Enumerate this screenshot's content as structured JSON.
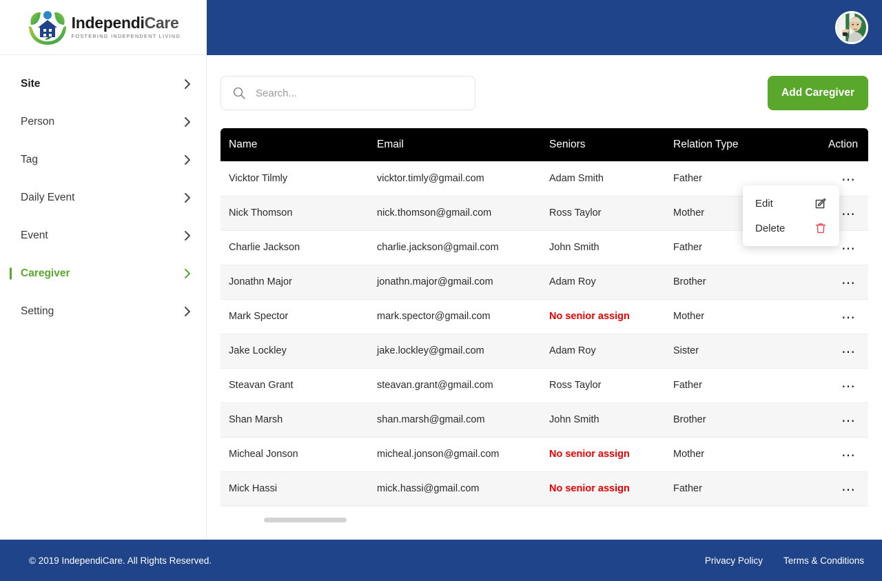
{
  "brand": {
    "logo_icon": "independicare-logo-icon",
    "name_part1": "Independi",
    "name_part2": "Care",
    "tagline": "FOSTERING INDEPENDENT LIVING"
  },
  "header": {
    "avatar_icon": "user-avatar",
    "bg_color": "#1f4489"
  },
  "sidebar": {
    "items": [
      {
        "label": "Site",
        "chevron": "chevron-right-icon",
        "state": "bold"
      },
      {
        "label": "Person",
        "chevron": "chevron-right-icon",
        "state": "normal"
      },
      {
        "label": "Tag",
        "chevron": "chevron-right-icon",
        "state": "normal"
      },
      {
        "label": "Daily Event",
        "chevron": "chevron-right-icon",
        "state": "normal"
      },
      {
        "label": "Event",
        "chevron": "chevron-right-icon",
        "state": "normal"
      },
      {
        "label": "Caregiver",
        "chevron": "chevron-right-icon",
        "state": "active"
      },
      {
        "label": "Setting",
        "chevron": "chevron-right-icon",
        "state": "normal"
      }
    ],
    "active_color": "#5aa82b"
  },
  "toolbar": {
    "search_placeholder": "Search...",
    "search_value": "",
    "search_icon": "search-icon",
    "add_button_label": "Add Caregiver",
    "add_button_color": "#5aa82b"
  },
  "table": {
    "columns": [
      "Name",
      "Email",
      "Seniors",
      "Relation Type",
      "Action"
    ],
    "no_senior_text": "No senior assign",
    "no_senior_color": "#ee0000",
    "action_icon": "more-options-icon",
    "rows": [
      {
        "name": "Vicktor Tilmly",
        "email": "vicktor.timly@gmail.com",
        "seniors": "Adam Smith",
        "relation": "Father",
        "no_senior": false
      },
      {
        "name": "Nick Thomson",
        "email": "nick.thomson@gmail.com",
        "seniors": "Ross Taylor",
        "relation": "Mother",
        "no_senior": false
      },
      {
        "name": "Charlie Jackson",
        "email": "charlie.jackson@gmail.com",
        "seniors": "John Smith",
        "relation": "Father",
        "no_senior": false
      },
      {
        "name": "Jonathn Major",
        "email": "jonathn.major@gmail.com",
        "seniors": "Adam Roy",
        "relation": "Brother",
        "no_senior": false
      },
      {
        "name": "Mark Spector",
        "email": "mark.spector@gmail.com",
        "seniors": "No senior assign",
        "relation": "Mother",
        "no_senior": true
      },
      {
        "name": "Jake Lockley",
        "email": "jake.lockley@gmail.com",
        "seniors": "Adam Roy",
        "relation": "Sister",
        "no_senior": false
      },
      {
        "name": "Steavan Grant",
        "email": "steavan.grant@gmail.com",
        "seniors": "Ross Taylor",
        "relation": "Father",
        "no_senior": false
      },
      {
        "name": "Shan Marsh",
        "email": "shan.marsh@gmail.com",
        "seniors": "John Smith",
        "relation": "Brother",
        "no_senior": false
      },
      {
        "name": "Micheal Jonson",
        "email": "micheal.jonson@gmail.com",
        "seniors": "No senior assign",
        "relation": "Mother",
        "no_senior": true
      },
      {
        "name": "Mick Hassi",
        "email": "mick.hassi@gmail.com",
        "seniors": "No senior assign",
        "relation": "Father",
        "no_senior": true
      }
    ]
  },
  "dropdown": {
    "open_for_row": 0,
    "items": [
      {
        "label": "Edit",
        "icon": "edit-pencil-icon",
        "icon_color": "#3a3a3a"
      },
      {
        "label": "Delete",
        "icon": "trash-bin-icon",
        "icon_color": "#f0424f"
      }
    ]
  },
  "footer": {
    "copyright": "© 2019 IndependiCare. All Rights Reserved.",
    "links": [
      "Privacy Policy",
      "Terms & Conditions"
    ],
    "bg_color": "#1f4489"
  }
}
